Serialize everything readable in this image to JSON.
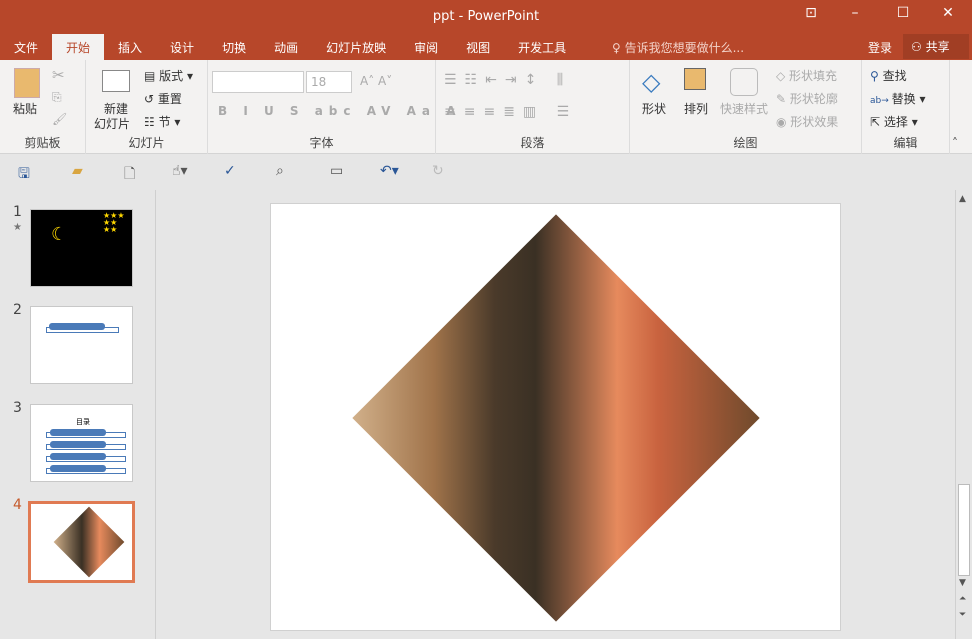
{
  "window": {
    "title": "ppt - PowerPoint"
  },
  "tabs": [
    "文件",
    "开始",
    "插入",
    "设计",
    "切换",
    "动画",
    "幻灯片放映",
    "审阅",
    "视图",
    "开发工具"
  ],
  "tell_me": "告诉我您想要做什么...",
  "login": "登录",
  "share": "共享",
  "ribbon": {
    "clipboard": {
      "label": "剪贴板",
      "paste": "粘贴"
    },
    "slides": {
      "label": "幻灯片",
      "new_slide_1": "新建",
      "new_slide_2": "幻灯片",
      "layout": "版式",
      "reset": "重置",
      "section": "节"
    },
    "font": {
      "label": "字体",
      "font_name": "",
      "font_size": "18"
    },
    "paragraph": {
      "label": "段落"
    },
    "drawing": {
      "label": "绘图",
      "shapes": "形状",
      "arrange": "排列",
      "quick_styles": "快速样式",
      "fill": "形状填充",
      "outline": "形状轮廓",
      "effects": "形状效果"
    },
    "editing": {
      "label": "编辑",
      "find": "查找",
      "replace": "替换",
      "select": "选择"
    }
  },
  "slides": [
    {
      "num": "1"
    },
    {
      "num": "2"
    },
    {
      "num": "3",
      "title": "目录"
    },
    {
      "num": "4"
    }
  ],
  "selected_slide": 4,
  "colors": {
    "accent": "#b7472a"
  }
}
